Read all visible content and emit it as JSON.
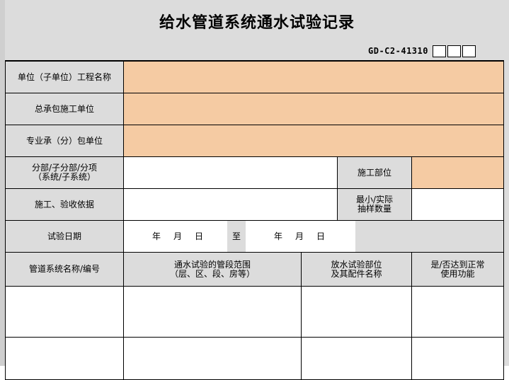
{
  "title": "给水管道系统通水试验记录",
  "code": "GD-C2-41310",
  "colors": {
    "peach": "#f5cba3",
    "label_bg": "#dcdcdc",
    "white": "#ffffff"
  },
  "rows": {
    "unit_project": {
      "label": "单位（子单位）工程名称"
    },
    "general_contractor": {
      "label": "总承包施工单位"
    },
    "sub_contractor": {
      "label": "专业承（分）包单位"
    },
    "division": {
      "label_line1": "分部/子分部/分项",
      "label_line2": "（系统/子系统）",
      "position_label": "施工部位"
    },
    "basis": {
      "label": "施工、验收依据",
      "sample_line1": "最小/实际",
      "sample_line2": "抽样数量"
    },
    "test_date": {
      "label": "试验日期",
      "year": "年",
      "month": "月",
      "day": "日",
      "to": "至"
    }
  },
  "table_headers": {
    "pipe_name": "管道系统名称/编号",
    "range_line1": "通水试验的管段范围",
    "range_line2": "（层、区、段、房等）",
    "drain_line1": "放水试验部位",
    "drain_line2": "及其配件名称",
    "func_line1": "是/否达到正常",
    "func_line2": "使用功能"
  }
}
